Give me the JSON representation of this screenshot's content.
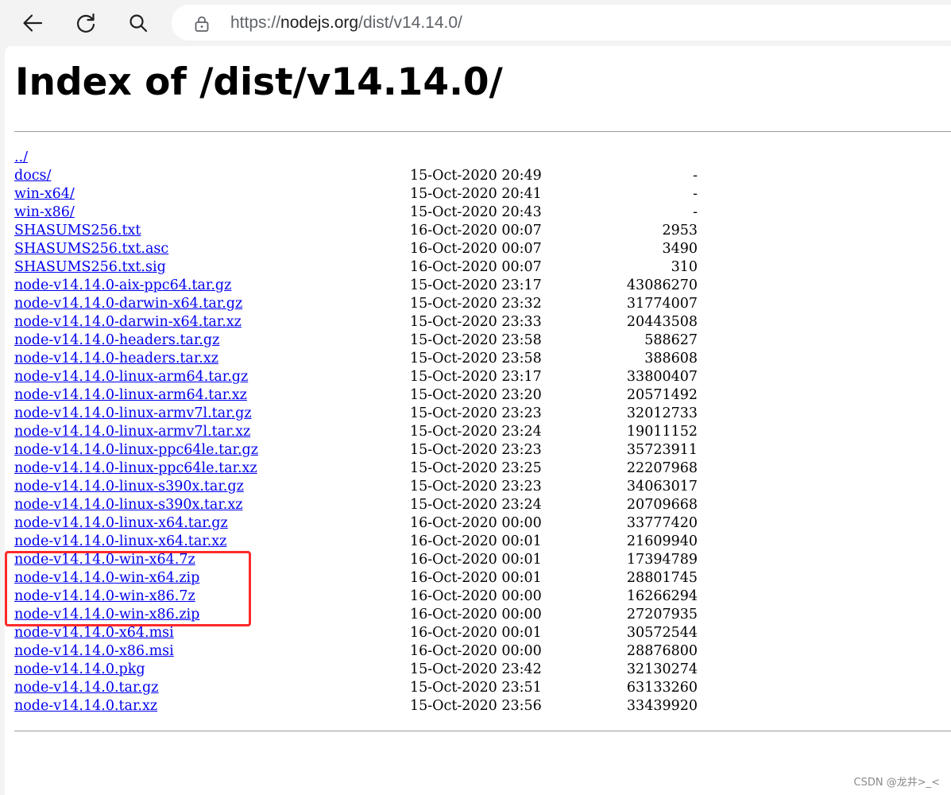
{
  "browser": {
    "url_prefix": "https://",
    "url_host": "nodejs.org",
    "url_path": "/dist/v14.14.0/",
    "icons": {
      "back": "back-arrow-icon",
      "reload": "reload-icon",
      "search": "search-icon",
      "lock": "lock-icon"
    }
  },
  "page": {
    "title": "Index of /dist/v14.14.0/",
    "entries": [
      {
        "name": "../",
        "date": "",
        "size": ""
      },
      {
        "name": "docs/",
        "date": "15-Oct-2020 20:49",
        "size": "-"
      },
      {
        "name": "win-x64/",
        "date": "15-Oct-2020 20:41",
        "size": "-"
      },
      {
        "name": "win-x86/",
        "date": "15-Oct-2020 20:43",
        "size": "-"
      },
      {
        "name": "SHASUMS256.txt",
        "date": "16-Oct-2020 00:07",
        "size": "2953"
      },
      {
        "name": "SHASUMS256.txt.asc",
        "date": "16-Oct-2020 00:07",
        "size": "3490"
      },
      {
        "name": "SHASUMS256.txt.sig",
        "date": "16-Oct-2020 00:07",
        "size": "310"
      },
      {
        "name": "node-v14.14.0-aix-ppc64.tar.gz",
        "date": "15-Oct-2020 23:17",
        "size": "43086270"
      },
      {
        "name": "node-v14.14.0-darwin-x64.tar.gz",
        "date": "15-Oct-2020 23:32",
        "size": "31774007"
      },
      {
        "name": "node-v14.14.0-darwin-x64.tar.xz",
        "date": "15-Oct-2020 23:33",
        "size": "20443508"
      },
      {
        "name": "node-v14.14.0-headers.tar.gz",
        "date": "15-Oct-2020 23:58",
        "size": "588627"
      },
      {
        "name": "node-v14.14.0-headers.tar.xz",
        "date": "15-Oct-2020 23:58",
        "size": "388608"
      },
      {
        "name": "node-v14.14.0-linux-arm64.tar.gz",
        "date": "15-Oct-2020 23:17",
        "size": "33800407"
      },
      {
        "name": "node-v14.14.0-linux-arm64.tar.xz",
        "date": "15-Oct-2020 23:20",
        "size": "20571492"
      },
      {
        "name": "node-v14.14.0-linux-armv7l.tar.gz",
        "date": "15-Oct-2020 23:23",
        "size": "32012733"
      },
      {
        "name": "node-v14.14.0-linux-armv7l.tar.xz",
        "date": "15-Oct-2020 23:24",
        "size": "19011152"
      },
      {
        "name": "node-v14.14.0-linux-ppc64le.tar.gz",
        "date": "15-Oct-2020 23:23",
        "size": "35723911"
      },
      {
        "name": "node-v14.14.0-linux-ppc64le.tar.xz",
        "date": "15-Oct-2020 23:25",
        "size": "22207968"
      },
      {
        "name": "node-v14.14.0-linux-s390x.tar.gz",
        "date": "15-Oct-2020 23:23",
        "size": "34063017"
      },
      {
        "name": "node-v14.14.0-linux-s390x.tar.xz",
        "date": "15-Oct-2020 23:24",
        "size": "20709668"
      },
      {
        "name": "node-v14.14.0-linux-x64.tar.gz",
        "date": "16-Oct-2020 00:00",
        "size": "33777420"
      },
      {
        "name": "node-v14.14.0-linux-x64.tar.xz",
        "date": "16-Oct-2020 00:01",
        "size": "21609940"
      },
      {
        "name": "node-v14.14.0-win-x64.7z",
        "date": "16-Oct-2020 00:01",
        "size": "17394789"
      },
      {
        "name": "node-v14.14.0-win-x64.zip",
        "date": "16-Oct-2020 00:01",
        "size": "28801745"
      },
      {
        "name": "node-v14.14.0-win-x86.7z",
        "date": "16-Oct-2020 00:00",
        "size": "16266294"
      },
      {
        "name": "node-v14.14.0-win-x86.zip",
        "date": "16-Oct-2020 00:00",
        "size": "27207935"
      },
      {
        "name": "node-v14.14.0-x64.msi",
        "date": "16-Oct-2020 00:01",
        "size": "30572544"
      },
      {
        "name": "node-v14.14.0-x86.msi",
        "date": "16-Oct-2020 00:00",
        "size": "28876800"
      },
      {
        "name": "node-v14.14.0.pkg",
        "date": "15-Oct-2020 23:42",
        "size": "32130274"
      },
      {
        "name": "node-v14.14.0.tar.gz",
        "date": "15-Oct-2020 23:51",
        "size": "63133260"
      },
      {
        "name": "node-v14.14.0.tar.xz",
        "date": "15-Oct-2020 23:56",
        "size": "33439920"
      }
    ]
  },
  "annotation": {
    "color": "#ff2a2a"
  },
  "watermark": "CSDN @龙井>_<"
}
